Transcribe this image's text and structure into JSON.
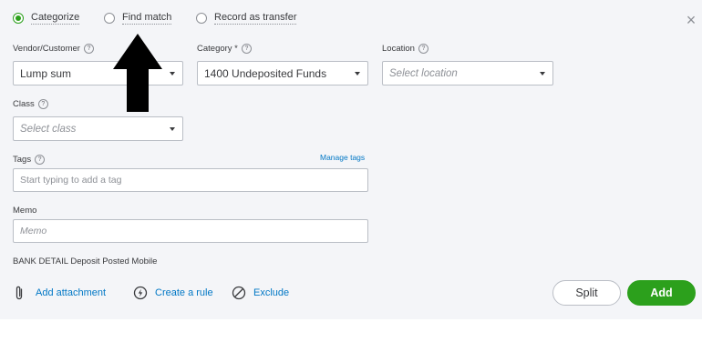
{
  "radios": {
    "categorize": "Categorize",
    "find_match": "Find match",
    "record_transfer": "Record as transfer",
    "selected": "categorize"
  },
  "fields": {
    "vendor_label": "Vendor/Customer",
    "vendor_value": "Lump sum",
    "category_label": "Category *",
    "category_value": "1400 Undeposited Funds",
    "location_label": "Location",
    "location_placeholder": "Select location",
    "class_label": "Class",
    "class_placeholder": "Select class",
    "tags_label": "Tags",
    "manage_tags": "Manage tags",
    "tags_placeholder": "Start typing to add a tag",
    "memo_label": "Memo",
    "memo_placeholder": "Memo"
  },
  "bank_detail": {
    "label": "BANK DETAIL",
    "value": "Deposit Posted Mobile"
  },
  "actions": {
    "add_attachment": "Add attachment",
    "create_rule": "Create a rule",
    "exclude": "Exclude"
  },
  "buttons": {
    "split": "Split",
    "add": "Add"
  },
  "icons": {
    "help": "?",
    "close": "×"
  },
  "colors": {
    "accent_green": "#2ca01c",
    "link_blue": "#0077c5",
    "panel_bg": "#f4f5f8"
  }
}
